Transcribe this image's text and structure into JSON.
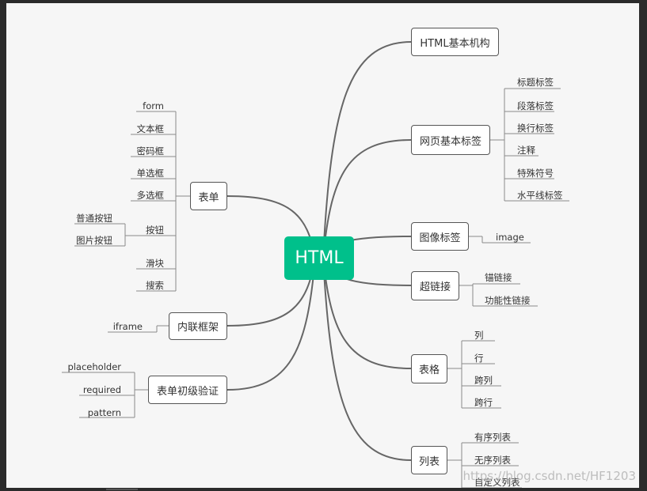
{
  "root": "HTML",
  "right": [
    {
      "label": "HTML基本机构",
      "leaves": []
    },
    {
      "label": "网页基本标签",
      "leaves": [
        "标题标签",
        "段落标签",
        "换行标签",
        "注释",
        "特殊符号",
        "水平线标签"
      ]
    },
    {
      "label": "图像标签",
      "leaves": [
        "image"
      ]
    },
    {
      "label": "超链接",
      "leaves": [
        "锚链接",
        "功能性链接"
      ]
    },
    {
      "label": "表格",
      "leaves": [
        "列",
        "行",
        "跨列",
        "跨行"
      ]
    },
    {
      "label": "列表",
      "leaves": [
        "有序列表",
        "无序列表",
        "自定义列表"
      ]
    }
  ],
  "left": [
    {
      "label": "表单",
      "leaves": [
        "form",
        "文本框",
        "密码框",
        "单选框",
        "多选框",
        "按钮",
        "滑块",
        "搜索"
      ],
      "subleaves": {
        "parent": "按钮",
        "items": [
          "普通按钮",
          "图片按钮"
        ]
      }
    },
    {
      "label": "内联框架",
      "leaves": [
        "iframe"
      ]
    },
    {
      "label": "表单初级验证",
      "leaves": [
        "placeholder",
        "required",
        "pattern"
      ]
    }
  ],
  "watermark": "https://blog.csdn.net/HF1203"
}
